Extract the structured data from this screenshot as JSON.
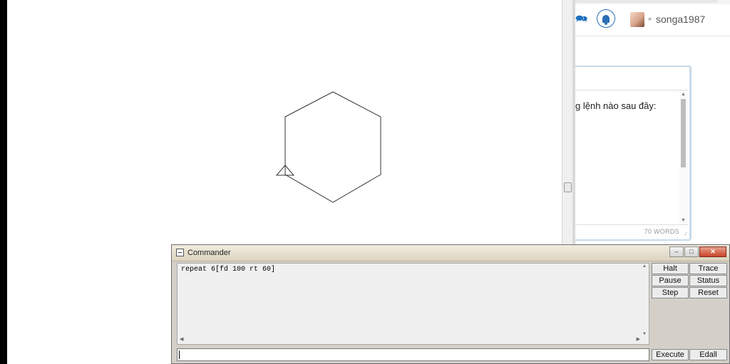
{
  "browser": {
    "username": "songa1987",
    "question_text": "g lệnh nào sau đây:",
    "word_count": "70 WORDS"
  },
  "commander": {
    "title": "Commander",
    "history": "repeat 6[fd 100 rt 60]",
    "input_value": "",
    "buttons": {
      "halt": "Halt",
      "trace": "Trace",
      "pause": "Pause",
      "status": "Status",
      "step": "Step",
      "reset": "Reset",
      "execute": "Execute",
      "edall": "Edall"
    }
  },
  "turtle": {
    "program": "repeat 6[fd 100 rt 60]",
    "sides": 6,
    "side_length": 100,
    "turn_angle": 60
  },
  "colors": {
    "line": "#333333",
    "accent_blue": "#2a6fb5"
  }
}
